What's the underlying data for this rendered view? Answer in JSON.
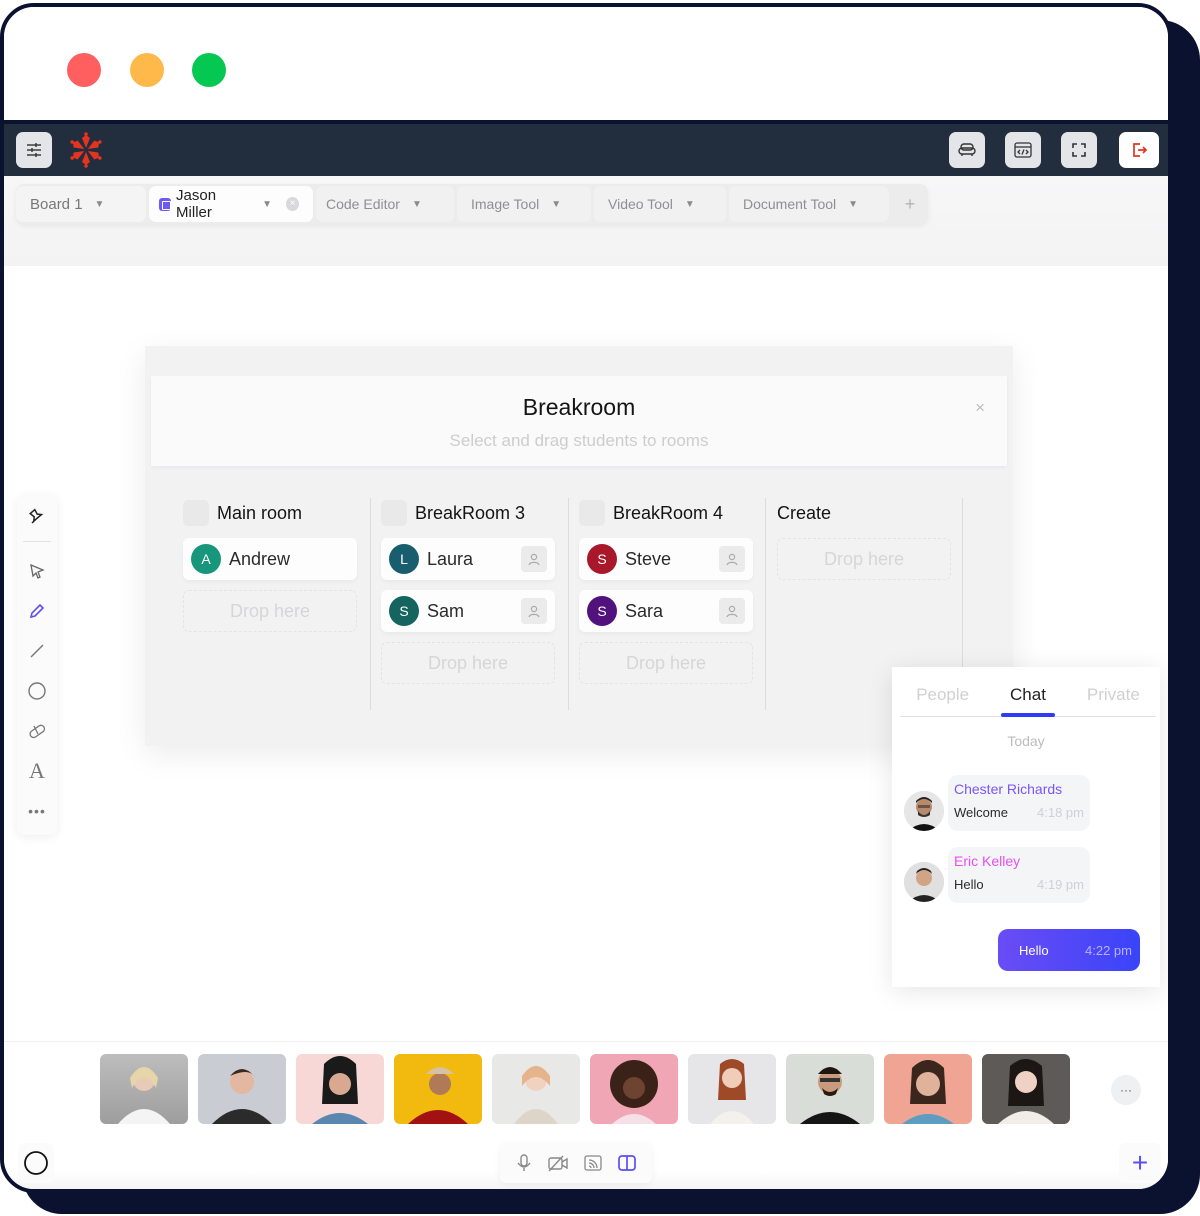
{
  "window": {
    "traffic_lights": [
      {
        "name": "close",
        "color": "#ff5f5f"
      },
      {
        "name": "minimize",
        "color": "#ffb84a"
      },
      {
        "name": "maximize",
        "color": "#05c853"
      }
    ]
  },
  "appbar": {
    "settings_icon": "sliders-icon",
    "logo_icon": "snowflake-logo-icon",
    "logo_color": "#e2341f",
    "right_buttons": [
      {
        "name": "breakroom-button",
        "icon": "sofa-icon"
      },
      {
        "name": "code-embed-button",
        "icon": "code-window-icon"
      },
      {
        "name": "fullscreen-button",
        "icon": "fullscreen-icon"
      },
      {
        "name": "exit-button",
        "icon": "exit-icon"
      }
    ]
  },
  "tabs": [
    {
      "label": "Board 1",
      "dropdown": true,
      "active": false
    },
    {
      "label": "Jason Miller",
      "dropdown": true,
      "active": true,
      "closable": true
    },
    {
      "label": "Code Editor",
      "dropdown": true,
      "active": false
    },
    {
      "label": "Image Tool",
      "dropdown": true,
      "active": false
    },
    {
      "label": "Video Tool",
      "dropdown": true,
      "active": false
    },
    {
      "label": "Document Tool",
      "dropdown": true,
      "active": false
    }
  ],
  "tab_add_label": "+",
  "breakroom": {
    "title": "Breakroom",
    "subtitle": "Select and drag students to rooms",
    "close_label": "×",
    "drop_label": "Drop here",
    "rooms": [
      {
        "name": "Main room",
        "members": [
          {
            "initial": "A",
            "name": "Andrew",
            "color": "#17967b",
            "assign_button": false
          }
        ]
      },
      {
        "name": "BreakRoom 3",
        "members": [
          {
            "initial": "L",
            "name": "Laura",
            "color": "#185e6e",
            "assign_button": true
          },
          {
            "initial": "S",
            "name": "Sam",
            "color": "#16645f",
            "assign_button": true
          }
        ]
      },
      {
        "name": "BreakRoom 4",
        "members": [
          {
            "initial": "S",
            "name": "Steve",
            "color": "#a8182a",
            "assign_button": true
          },
          {
            "initial": "S",
            "name": "Sara",
            "color": "#52127e",
            "assign_button": true
          }
        ]
      }
    ],
    "create_label": "Create"
  },
  "left_toolbar": {
    "tools": [
      "pin-icon",
      "select-arrow-icon",
      "pencil-icon",
      "line-icon",
      "circle-icon",
      "eraser-icon",
      "text-icon",
      "more-icon"
    ],
    "active_tool": "pencil-icon",
    "accent": "#5b4ef5"
  },
  "chat": {
    "tabs": [
      "People",
      "Chat",
      "Private"
    ],
    "active_tab": "Chat",
    "date_label": "Today",
    "messages": [
      {
        "author": "Chester Richards",
        "author_color": "#7b55f5",
        "text": "Welcome",
        "time": "4:18 pm"
      },
      {
        "author": "Eric Kelley",
        "author_color": "#e94ff0",
        "text": "Hello",
        "time": "4:19 pm"
      }
    ],
    "outgoing": {
      "text": "Hello",
      "time": "4:22 pm"
    }
  },
  "participants": {
    "count": 10,
    "more_label": "···"
  },
  "media_controls": [
    "microphone-icon",
    "camera-off-icon",
    "cast-icon",
    "layout-split-icon"
  ],
  "add_label": "+"
}
